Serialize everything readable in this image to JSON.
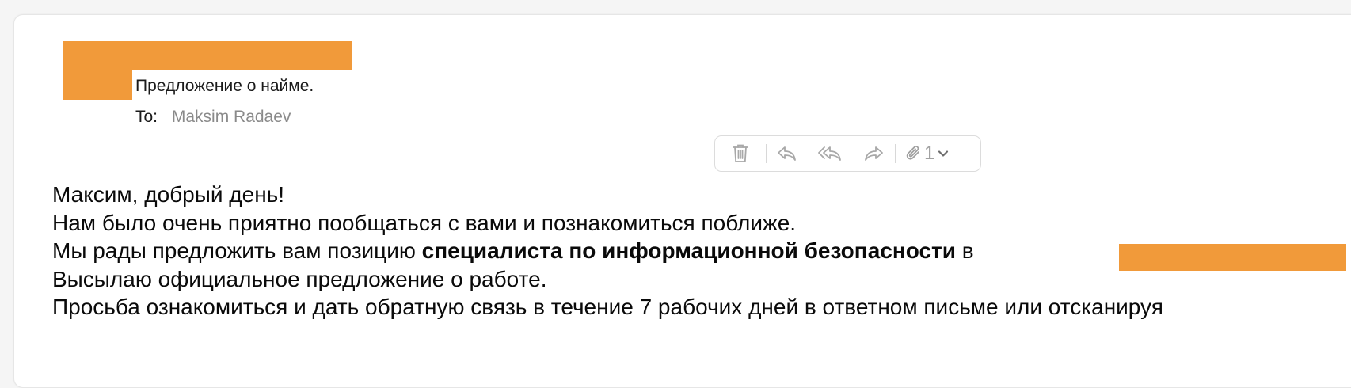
{
  "header": {
    "subject": "Предложение о найме.",
    "to_label": "To:",
    "to_value": "Maksim Radaev"
  },
  "toolbar": {
    "delete_icon": "trash-icon",
    "reply_icon": "reply-icon",
    "reply_all_icon": "reply-all-icon",
    "forward_icon": "forward-icon",
    "attachment_icon": "paperclip-icon",
    "attachment_count": "1"
  },
  "body": {
    "greeting": "Максим, добрый день!",
    "line2": "Нам было очень приятно пообщаться с вами и познакомиться поближе.",
    "line3_pre": "Мы рады предложить вам позицию ",
    "line3_bold": "специалиста по информационной безопасности",
    "line3_post": " в",
    "line4": "Высылаю официальное предложение о работе.",
    "line5": "Просьба ознакомиться и дать обратную связь в течение 7 рабочих дней в ответном письме или отсканируя"
  },
  "colors": {
    "redaction": "#f19a3a",
    "icon_gray": "#a8a8a8",
    "secondary_text": "#8a8a8a"
  }
}
